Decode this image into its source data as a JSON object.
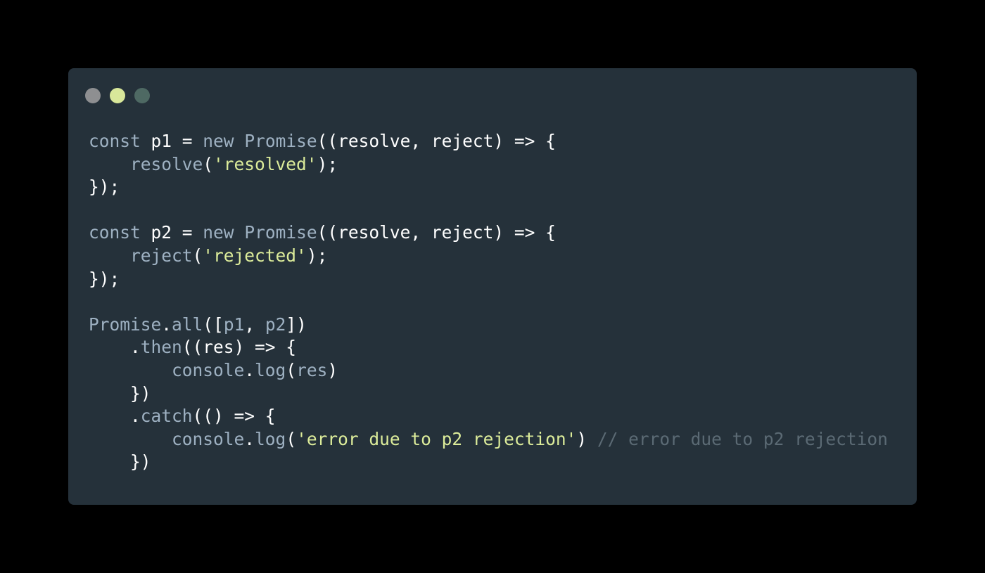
{
  "window": {
    "controls": [
      {
        "name": "close",
        "color": "#8e8f91"
      },
      {
        "name": "minimize",
        "color": "#d8e79a"
      },
      {
        "name": "maximize",
        "color": "#4e6963"
      }
    ]
  },
  "colors": {
    "background": "#000000",
    "editor": "#25313a",
    "keyword": "#9eb1c2",
    "identifier": "#ffffff",
    "string": "#dcec9a",
    "comment": "#5b6a74"
  },
  "code": {
    "lines": [
      [
        {
          "t": "kw",
          "v": "const"
        },
        {
          "t": "id",
          "v": " p1 = "
        },
        {
          "t": "kw",
          "v": "new"
        },
        {
          "t": "id",
          "v": " "
        },
        {
          "t": "fn",
          "v": "Promise"
        },
        {
          "t": "punct",
          "v": "((resolve, reject) => {"
        }
      ],
      [
        {
          "t": "id",
          "v": "    "
        },
        {
          "t": "fn",
          "v": "resolve"
        },
        {
          "t": "punct",
          "v": "("
        },
        {
          "t": "str",
          "v": "'resolved'"
        },
        {
          "t": "punct",
          "v": ");"
        }
      ],
      [
        {
          "t": "punct",
          "v": "});"
        }
      ],
      [],
      [
        {
          "t": "kw",
          "v": "const"
        },
        {
          "t": "id",
          "v": " p2 = "
        },
        {
          "t": "kw",
          "v": "new"
        },
        {
          "t": "id",
          "v": " "
        },
        {
          "t": "fn",
          "v": "Promise"
        },
        {
          "t": "punct",
          "v": "((resolve, reject) => {"
        }
      ],
      [
        {
          "t": "id",
          "v": "    "
        },
        {
          "t": "fn",
          "v": "reject"
        },
        {
          "t": "punct",
          "v": "("
        },
        {
          "t": "str",
          "v": "'rejected'"
        },
        {
          "t": "punct",
          "v": ");"
        }
      ],
      [
        {
          "t": "punct",
          "v": "});"
        }
      ],
      [],
      [
        {
          "t": "fn",
          "v": "Promise"
        },
        {
          "t": "punct",
          "v": "."
        },
        {
          "t": "fn",
          "v": "all"
        },
        {
          "t": "punct",
          "v": "(["
        },
        {
          "t": "fn",
          "v": "p1"
        },
        {
          "t": "punct",
          "v": ", "
        },
        {
          "t": "fn",
          "v": "p2"
        },
        {
          "t": "punct",
          "v": "])"
        }
      ],
      [
        {
          "t": "id",
          "v": "    "
        },
        {
          "t": "punct",
          "v": "."
        },
        {
          "t": "fn",
          "v": "then"
        },
        {
          "t": "punct",
          "v": "((res) => {"
        }
      ],
      [
        {
          "t": "id",
          "v": "        "
        },
        {
          "t": "fn",
          "v": "console"
        },
        {
          "t": "punct",
          "v": "."
        },
        {
          "t": "fn",
          "v": "log"
        },
        {
          "t": "punct",
          "v": "("
        },
        {
          "t": "fn",
          "v": "res"
        },
        {
          "t": "punct",
          "v": ")"
        }
      ],
      [
        {
          "t": "id",
          "v": "    "
        },
        {
          "t": "punct",
          "v": "})"
        }
      ],
      [
        {
          "t": "id",
          "v": "    "
        },
        {
          "t": "punct",
          "v": "."
        },
        {
          "t": "fn",
          "v": "catch"
        },
        {
          "t": "punct",
          "v": "(() => {"
        }
      ],
      [
        {
          "t": "id",
          "v": "        "
        },
        {
          "t": "fn",
          "v": "console"
        },
        {
          "t": "punct",
          "v": "."
        },
        {
          "t": "fn",
          "v": "log"
        },
        {
          "t": "punct",
          "v": "("
        },
        {
          "t": "str",
          "v": "'error due to p2 rejection'"
        },
        {
          "t": "punct",
          "v": ") "
        },
        {
          "t": "cm",
          "v": "// error due to p2 rejection"
        }
      ],
      [
        {
          "t": "id",
          "v": "    "
        },
        {
          "t": "punct",
          "v": "})"
        }
      ]
    ]
  }
}
